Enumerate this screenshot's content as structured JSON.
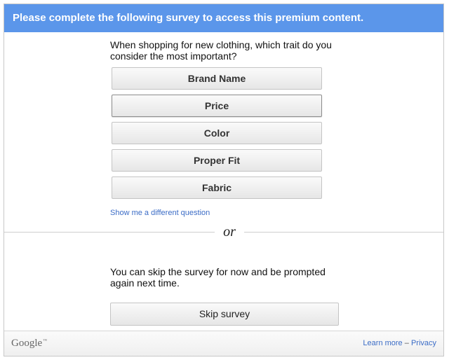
{
  "header": {
    "title": "Please complete the following survey to access this premium content."
  },
  "survey": {
    "question": "When shopping for new clothing, which trait do you consider the most important?",
    "answers": [
      "Brand Name",
      "Price",
      "Color",
      "Proper Fit",
      "Fabric"
    ],
    "different_question_link": "Show me a different question"
  },
  "divider": {
    "label": "or"
  },
  "skip": {
    "text": "You can skip the survey for now and be prompted again next time.",
    "button_label": "Skip survey"
  },
  "footer": {
    "logo_text": "Google",
    "logo_tm": "™",
    "learn_more": "Learn more",
    "separator": "–",
    "privacy": "Privacy"
  },
  "colors": {
    "header_bg": "#5b96ea",
    "link": "#3b6cc6"
  }
}
